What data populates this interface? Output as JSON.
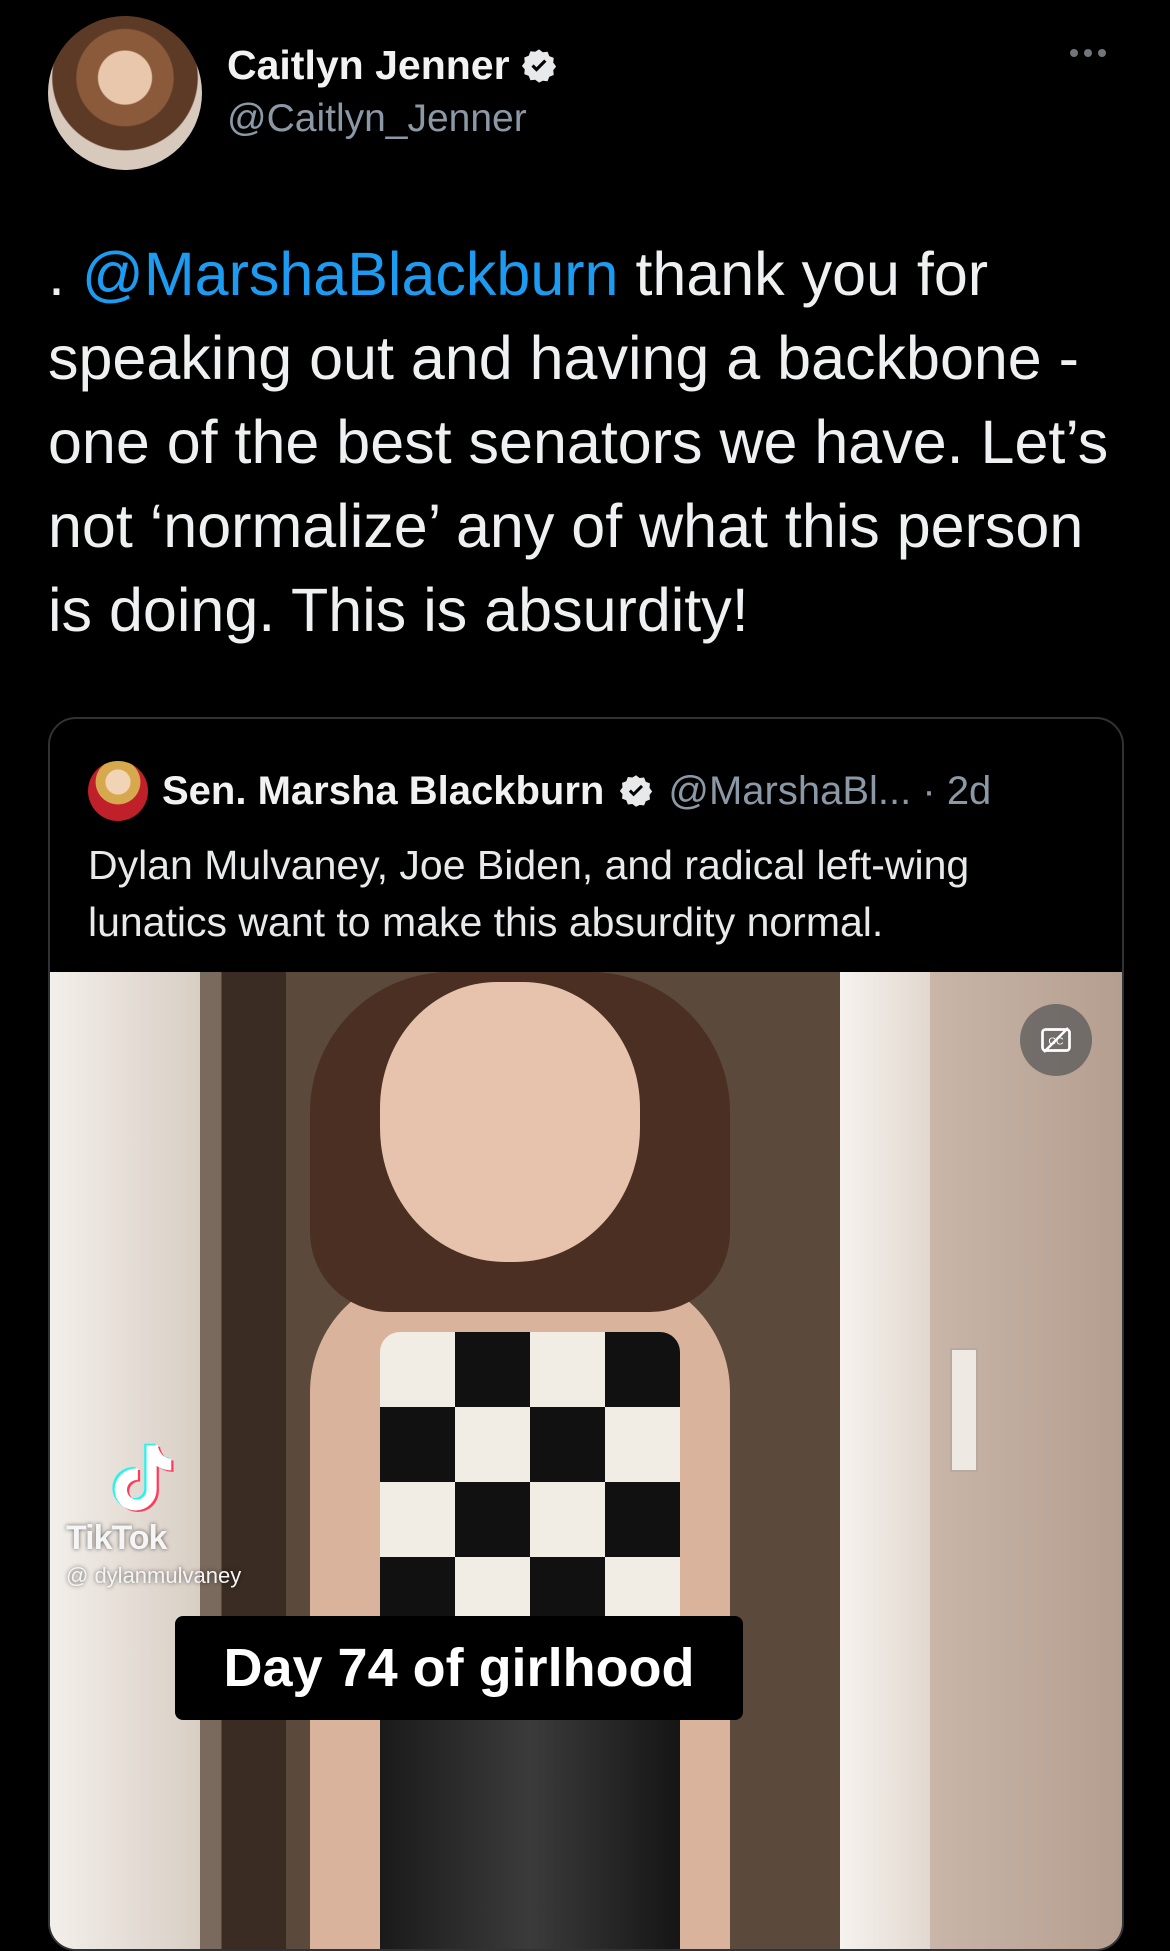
{
  "tweet": {
    "author": {
      "name": "Caitlyn Jenner",
      "handle": "@Caitlyn_Jenner"
    },
    "text_prefix": ". ",
    "mention": "@MarshaBlackburn",
    "text_rest": " thank you for speaking out and having a backbone - one of the best senators we have. Let’s not ‘normalize’ any of what this person is doing. This is absurdity!"
  },
  "quoted_tweet": {
    "author_name": "Sen. Marsha Blackburn",
    "handle_and_time": "@MarshaBl... · 2d",
    "text": "Dylan Mulvaney, Joe Biden, and radical left-wing lunatics want to make this absurdity normal.",
    "media": {
      "watermark_brand": "TikTok",
      "watermark_handle": "@ dylanmulvaney",
      "caption": "Day 74 of girlhood",
      "cc_icon": "closed-captions-icon"
    }
  },
  "icons": {
    "verified": "verified-badge-icon",
    "more": "more-options-icon"
  },
  "colors": {
    "background": "#000000",
    "mention": "#1d9bf0",
    "secondary_text": "#8b98a5",
    "border": "#2f3336"
  }
}
